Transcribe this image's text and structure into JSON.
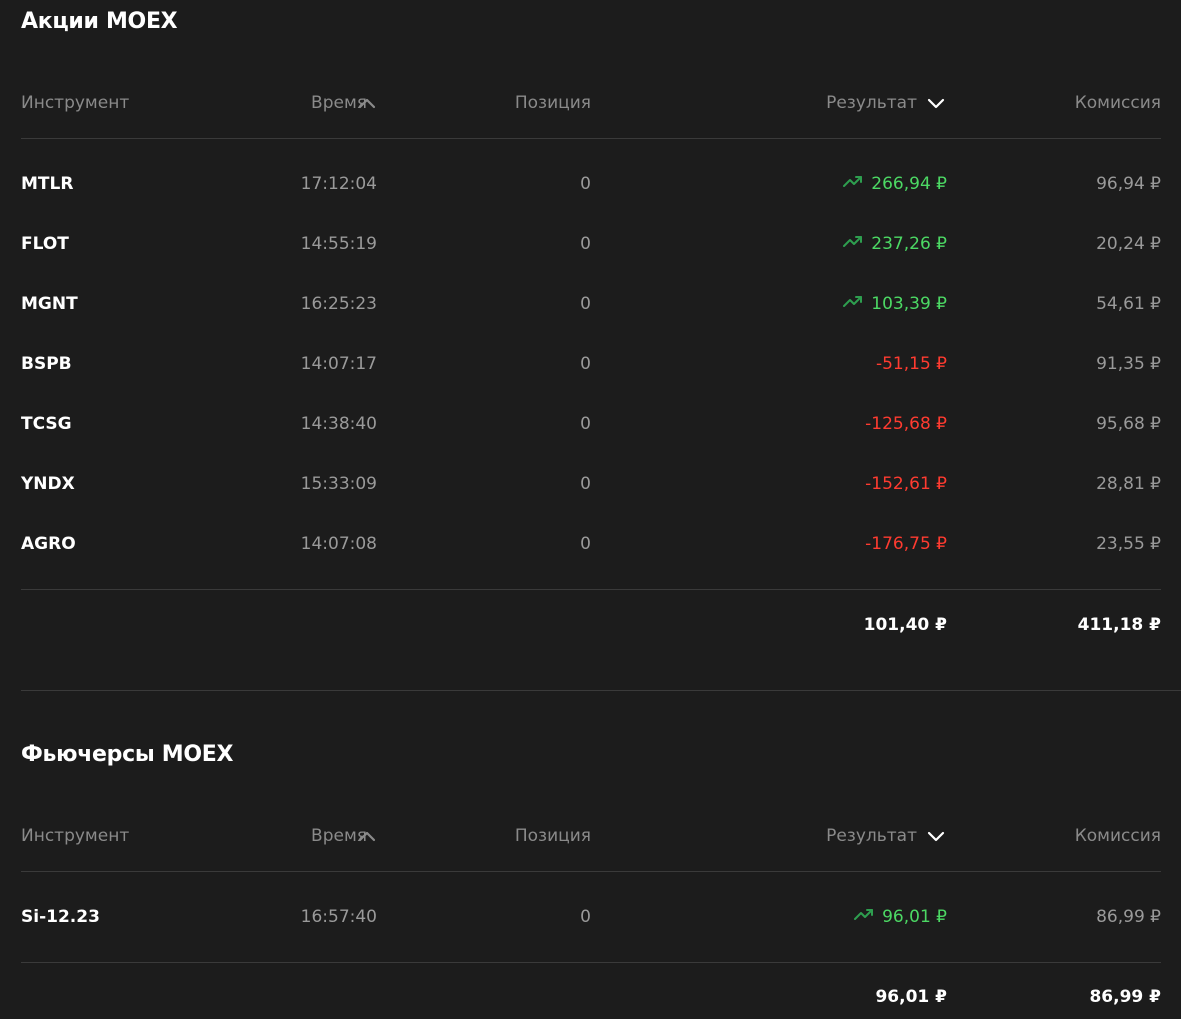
{
  "stocks": {
    "title": "Акции MOEX",
    "headers": {
      "instrument": "Инструмент",
      "time": "Время",
      "position": "Позиция",
      "result": "Результат",
      "commission": "Комиссия"
    },
    "rows": [
      {
        "instrument": "MTLR",
        "time": "17:12:04",
        "position": "0",
        "result": "266,94 ₽",
        "commission": "96,94 ₽",
        "trend": "up"
      },
      {
        "instrument": "FLOT",
        "time": "14:55:19",
        "position": "0",
        "result": "237,26 ₽",
        "commission": "20,24 ₽",
        "trend": "up"
      },
      {
        "instrument": "MGNT",
        "time": "16:25:23",
        "position": "0",
        "result": "103,39 ₽",
        "commission": "54,61 ₽",
        "trend": "up"
      },
      {
        "instrument": "BSPB",
        "time": "14:07:17",
        "position": "0",
        "result": "-51,15 ₽",
        "commission": "91,35 ₽",
        "trend": "down"
      },
      {
        "instrument": "TCSG",
        "time": "14:38:40",
        "position": "0",
        "result": "-125,68 ₽",
        "commission": "95,68 ₽",
        "trend": "down"
      },
      {
        "instrument": "YNDX",
        "time": "15:33:09",
        "position": "0",
        "result": "-152,61 ₽",
        "commission": "28,81 ₽",
        "trend": "down"
      },
      {
        "instrument": "AGRO",
        "time": "14:07:08",
        "position": "0",
        "result": "-176,75 ₽",
        "commission": "23,55 ₽",
        "trend": "down"
      }
    ],
    "total": {
      "result": "101,40 ₽",
      "commission": "411,18 ₽"
    }
  },
  "futures": {
    "title": "Фьючерсы MOEX",
    "headers": {
      "instrument": "Инструмент",
      "time": "Время",
      "position": "Позиция",
      "result": "Результат",
      "commission": "Комиссия"
    },
    "rows": [
      {
        "instrument": "Si-12.23",
        "time": "16:57:40",
        "position": "0",
        "result": "96,01 ₽",
        "commission": "86,99 ₽",
        "trend": "up"
      }
    ],
    "total": {
      "result": "96,01 ₽",
      "commission": "86,99 ₽"
    }
  },
  "colors": {
    "background": "#1c1c1c",
    "positive": "#4cd964",
    "positive_icon": "#2e9e4f",
    "negative": "#ff3b30",
    "muted": "#9a9a9a",
    "header": "#8a8a8a",
    "divider": "#3a3a3a"
  },
  "icons": {
    "sort_asc": "chevron-up-icon",
    "sort_desc": "chevron-down-icon",
    "trend_up": "trend-up-icon"
  }
}
